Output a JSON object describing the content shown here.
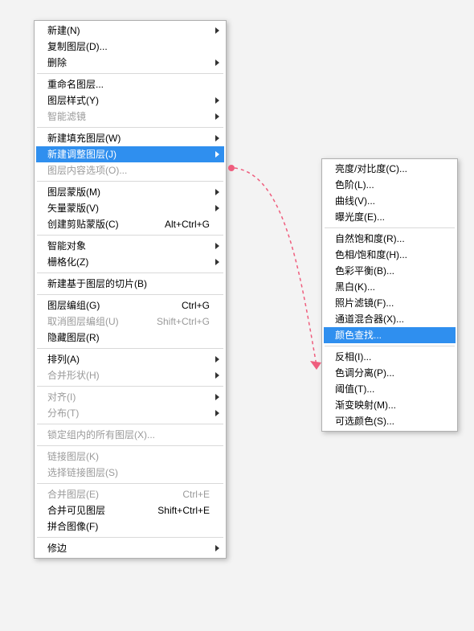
{
  "mainMenu": {
    "groups": [
      [
        {
          "label": "新建(N)",
          "shortcut": "",
          "hasSub": true,
          "disabled": false
        },
        {
          "label": "复制图层(D)...",
          "shortcut": "",
          "hasSub": false,
          "disabled": false
        },
        {
          "label": "删除",
          "shortcut": "",
          "hasSub": true,
          "disabled": false
        }
      ],
      [
        {
          "label": "重命名图层...",
          "shortcut": "",
          "hasSub": false,
          "disabled": false
        },
        {
          "label": "图层样式(Y)",
          "shortcut": "",
          "hasSub": true,
          "disabled": false
        },
        {
          "label": "智能滤镜",
          "shortcut": "",
          "hasSub": true,
          "disabled": true
        }
      ],
      [
        {
          "label": "新建填充图层(W)",
          "shortcut": "",
          "hasSub": true,
          "disabled": false
        },
        {
          "label": "新建调整图层(J)",
          "shortcut": "",
          "hasSub": true,
          "disabled": false,
          "highlight": true
        },
        {
          "label": "图层内容选项(O)...",
          "shortcut": "",
          "hasSub": false,
          "disabled": true
        }
      ],
      [
        {
          "label": "图层蒙版(M)",
          "shortcut": "",
          "hasSub": true,
          "disabled": false
        },
        {
          "label": "矢量蒙版(V)",
          "shortcut": "",
          "hasSub": true,
          "disabled": false
        },
        {
          "label": "创建剪贴蒙版(C)",
          "shortcut": "Alt+Ctrl+G",
          "hasSub": false,
          "disabled": false
        }
      ],
      [
        {
          "label": "智能对象",
          "shortcut": "",
          "hasSub": true,
          "disabled": false
        },
        {
          "label": "栅格化(Z)",
          "shortcut": "",
          "hasSub": true,
          "disabled": false
        }
      ],
      [
        {
          "label": "新建基于图层的切片(B)",
          "shortcut": "",
          "hasSub": false,
          "disabled": false
        }
      ],
      [
        {
          "label": "图层编组(G)",
          "shortcut": "Ctrl+G",
          "hasSub": false,
          "disabled": false
        },
        {
          "label": "取消图层编组(U)",
          "shortcut": "Shift+Ctrl+G",
          "hasSub": false,
          "disabled": true
        },
        {
          "label": "隐藏图层(R)",
          "shortcut": "",
          "hasSub": false,
          "disabled": false
        }
      ],
      [
        {
          "label": "排列(A)",
          "shortcut": "",
          "hasSub": true,
          "disabled": false
        },
        {
          "label": "合并形状(H)",
          "shortcut": "",
          "hasSub": true,
          "disabled": true
        }
      ],
      [
        {
          "label": "对齐(I)",
          "shortcut": "",
          "hasSub": true,
          "disabled": true
        },
        {
          "label": "分布(T)",
          "shortcut": "",
          "hasSub": true,
          "disabled": true
        }
      ],
      [
        {
          "label": "锁定组内的所有图层(X)...",
          "shortcut": "",
          "hasSub": false,
          "disabled": true
        }
      ],
      [
        {
          "label": "链接图层(K)",
          "shortcut": "",
          "hasSub": false,
          "disabled": true
        },
        {
          "label": "选择链接图层(S)",
          "shortcut": "",
          "hasSub": false,
          "disabled": true
        }
      ],
      [
        {
          "label": "合并图层(E)",
          "shortcut": "Ctrl+E",
          "hasSub": false,
          "disabled": true
        },
        {
          "label": "合并可见图层",
          "shortcut": "Shift+Ctrl+E",
          "hasSub": false,
          "disabled": false
        },
        {
          "label": "拼合图像(F)",
          "shortcut": "",
          "hasSub": false,
          "disabled": false
        }
      ],
      [
        {
          "label": "修边",
          "shortcut": "",
          "hasSub": true,
          "disabled": false
        }
      ]
    ]
  },
  "subMenu": {
    "groups": [
      [
        {
          "label": "亮度/对比度(C)...",
          "disabled": false
        },
        {
          "label": "色阶(L)...",
          "disabled": false
        },
        {
          "label": "曲线(V)...",
          "disabled": false
        },
        {
          "label": "曝光度(E)...",
          "disabled": false
        }
      ],
      [
        {
          "label": "自然饱和度(R)...",
          "disabled": false
        },
        {
          "label": "色相/饱和度(H)...",
          "disabled": false
        },
        {
          "label": "色彩平衡(B)...",
          "disabled": false
        },
        {
          "label": "黑白(K)...",
          "disabled": false
        },
        {
          "label": "照片滤镜(F)...",
          "disabled": false
        },
        {
          "label": "通道混合器(X)...",
          "disabled": false
        },
        {
          "label": "颜色查找...",
          "disabled": false,
          "highlight": true
        }
      ],
      [
        {
          "label": "反相(I)...",
          "disabled": false
        },
        {
          "label": "色调分离(P)...",
          "disabled": false
        },
        {
          "label": "阈值(T)...",
          "disabled": false
        },
        {
          "label": "渐变映射(M)...",
          "disabled": false
        },
        {
          "label": "可选颜色(S)...",
          "disabled": false
        }
      ]
    ]
  },
  "colors": {
    "highlight": "#2f8fef",
    "arrow": "#ef5d7d"
  }
}
